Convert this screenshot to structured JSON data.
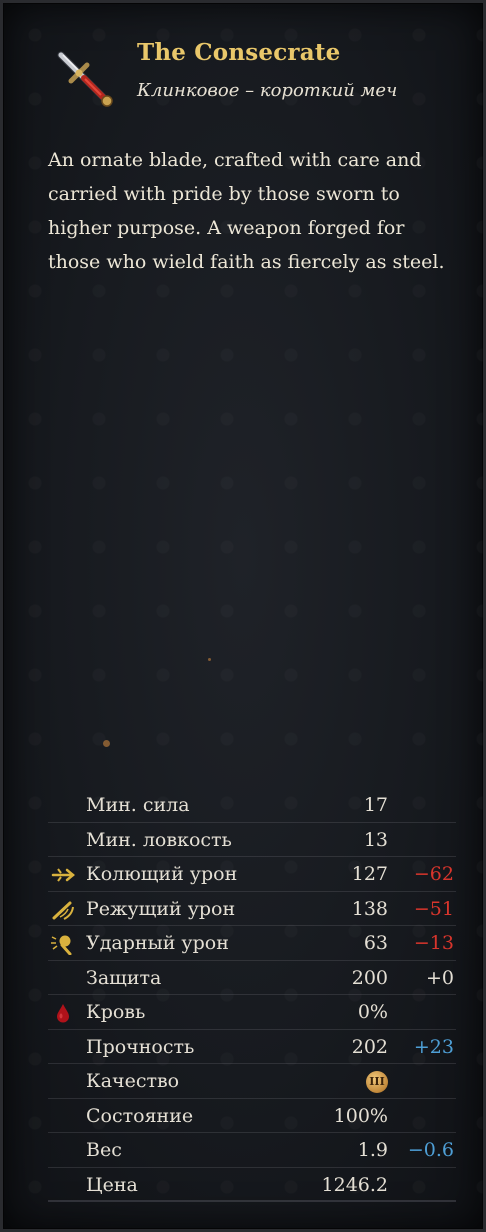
{
  "item": {
    "title": "The Consecrate",
    "subtitle": "Клинковое – короткий меч",
    "icon": "sword-icon",
    "description": [
      "An ornate blade, crafted with care and",
      "carried with pride by those sworn to",
      "higher purpose. A weapon forged for",
      "those who wield faith as fiercely as steel."
    ]
  },
  "colors": {
    "title": "#e9c76a",
    "penalty": "#d8352c",
    "bonus": "#4e9fd6"
  },
  "stats": [
    {
      "label": "Мин. сила",
      "value": "17",
      "mod": "",
      "icon": ""
    },
    {
      "label": "Мин. ловкость",
      "value": "13",
      "mod": "",
      "icon": ""
    },
    {
      "label": "Колющий урон",
      "value": "127",
      "mod": "−62",
      "icon": "pierce-icon"
    },
    {
      "label": "Режущий урон",
      "value": "138",
      "mod": "−51",
      "icon": "slash-icon"
    },
    {
      "label": "Ударный урон",
      "value": "63",
      "mod": "−13",
      "icon": "blunt-icon"
    },
    {
      "label": "Защита",
      "value": "200",
      "mod": "+0",
      "icon": ""
    },
    {
      "label": "Кровь",
      "value": "0%",
      "mod": "",
      "icon": "blood-drop-icon"
    },
    {
      "label": "Прочность",
      "value": "202",
      "mod": "+23",
      "icon": ""
    },
    {
      "label": "Качество",
      "value": "III",
      "mod": "",
      "icon": "quality-badge-icon"
    },
    {
      "label": "Состояние",
      "value": "100%",
      "mod": "",
      "icon": ""
    },
    {
      "label": "Вес",
      "value": "1.9",
      "mod": "−0.6",
      "icon": ""
    },
    {
      "label": "Цена",
      "value": "1246.2",
      "mod": "",
      "icon": ""
    }
  ]
}
